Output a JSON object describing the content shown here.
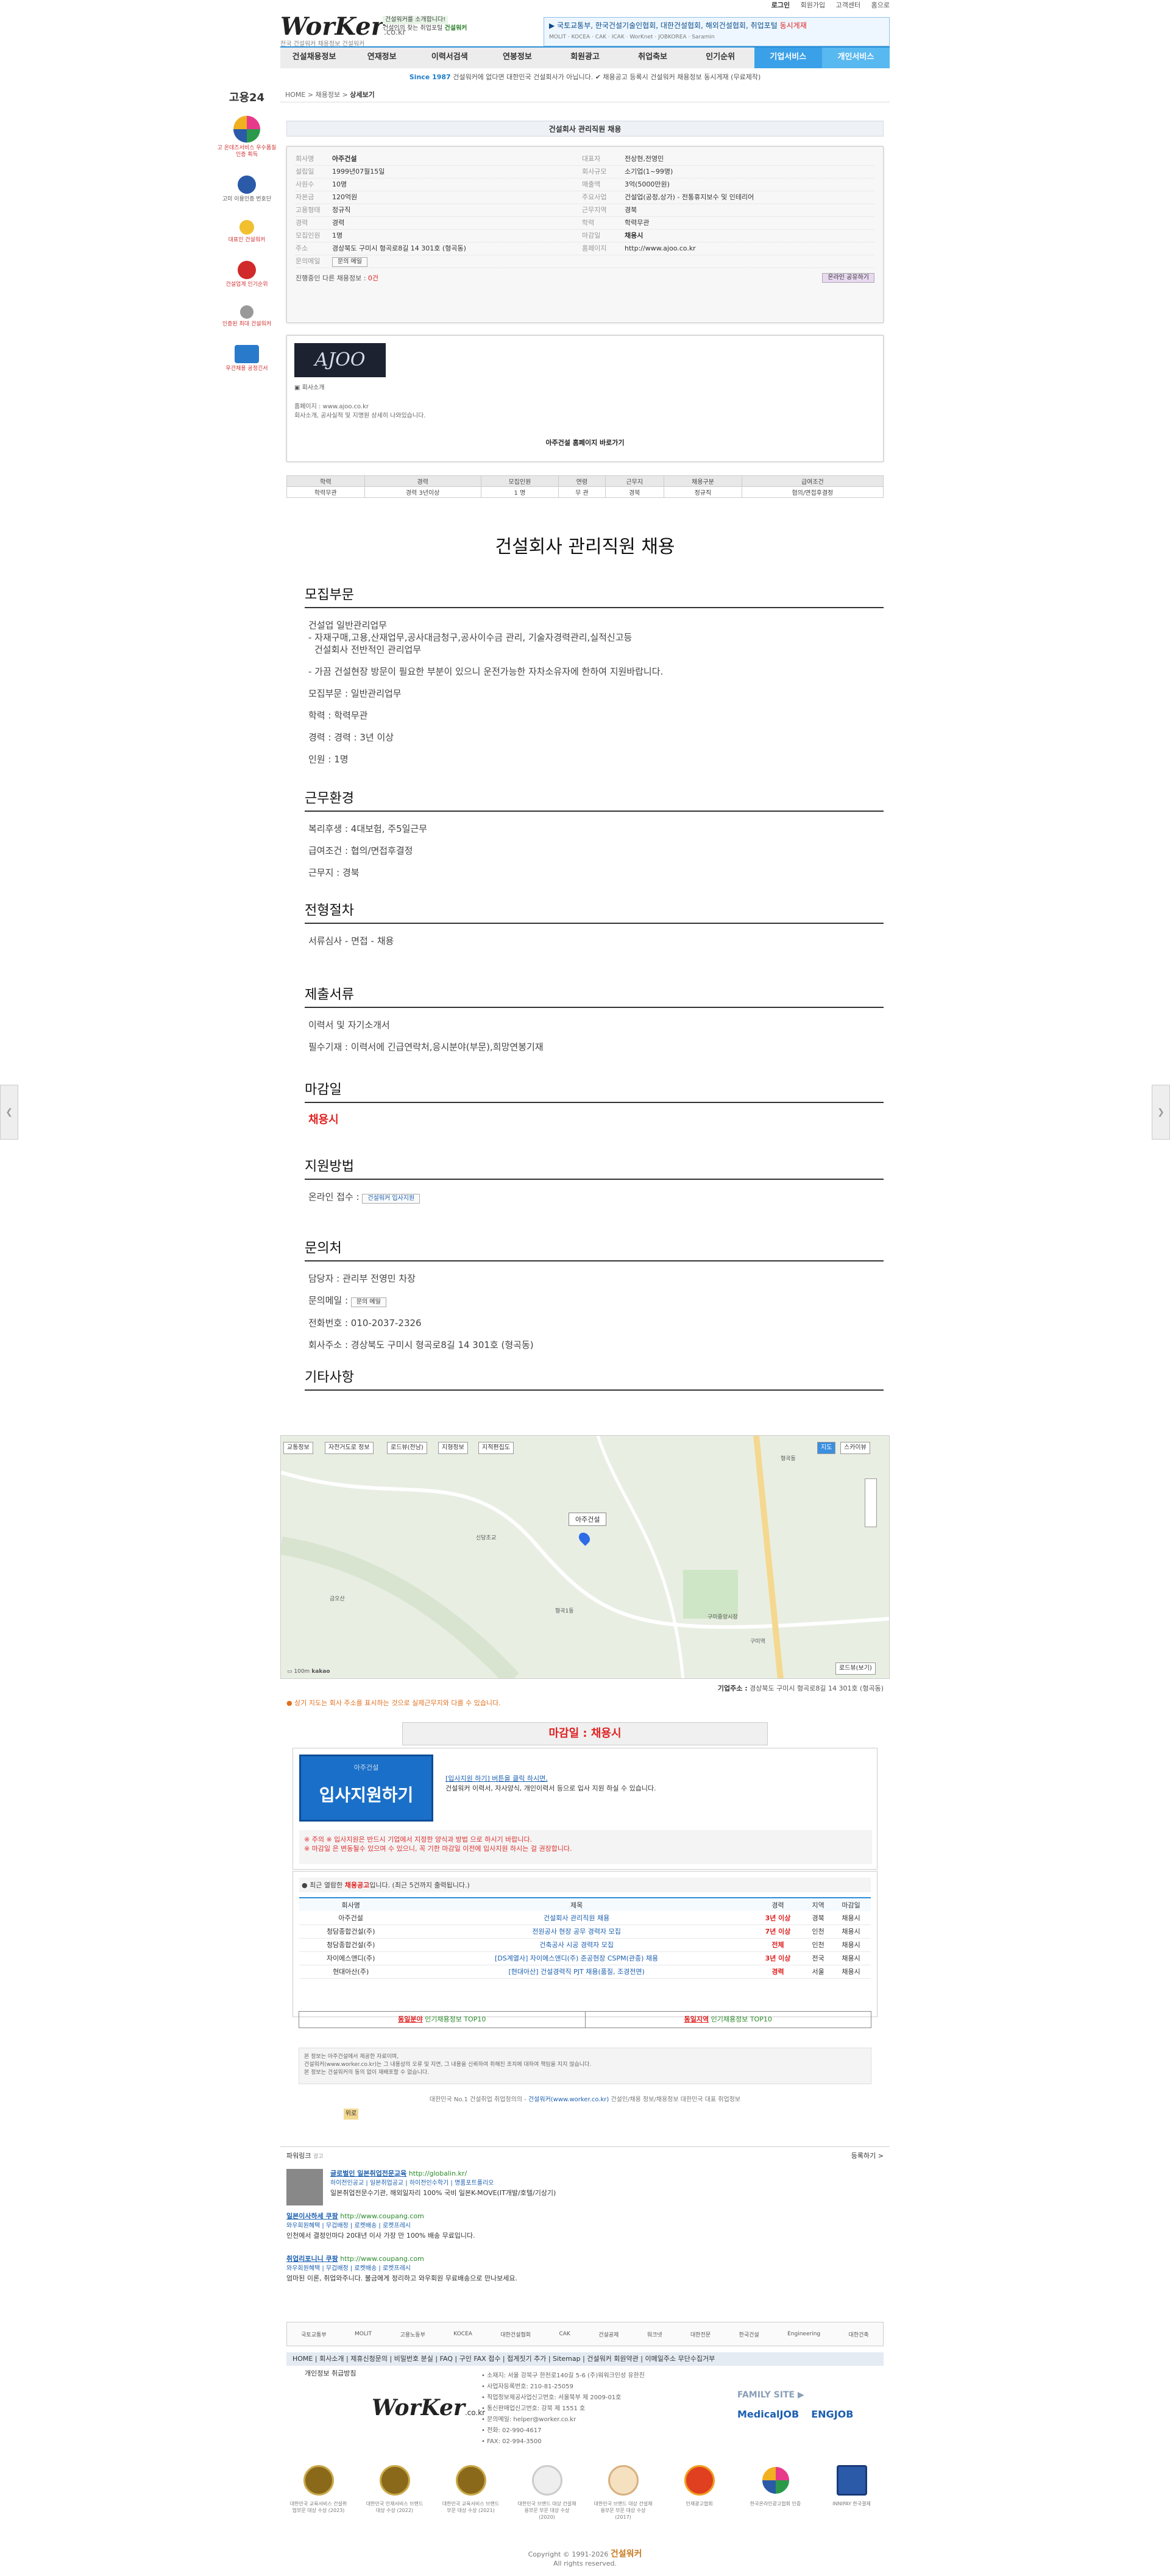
{
  "topbar": {
    "login": "로그인",
    "join": "회원가입",
    "customer": "고객센터",
    "home": "홈으로"
  },
  "logo": {
    "word": "WorKer",
    "domain": ".co.kr",
    "tagline": "전국 건설워커 채용정보 건설워커"
  },
  "hdrbanner": {
    "line1": "건설워커를 소개합니다!",
    "line2": "건설인의 찾는 취업포털",
    "brand": "건설워커"
  },
  "hdrnews": {
    "text": "▶ 국토교통부, 한국건설기술인협회, 대한건설협회, 해외건설협회, 취업포털",
    "highlight": "동시게재",
    "row2": "MOLIT · KOCEA · CAK · ICAK · WorKnet · JOBKOREA · Saramin"
  },
  "gnb": [
    {
      "label": "건설채용정보"
    },
    {
      "label": "연재정보"
    },
    {
      "label": "이력서검색"
    },
    {
      "label": "연봉정보"
    },
    {
      "label": "회원광고"
    },
    {
      "label": "취업축보"
    },
    {
      "label": "인기순위"
    },
    {
      "label": "기업서비스"
    },
    {
      "label": "개인서비스"
    }
  ],
  "since": {
    "lead": "Since 1987",
    "text": "건설워커에 없다면 대한민국 건설회사가 아닙니다. ✔ 채용공고 등록시 건설워커 채용정보 동시게재 (무료제작)"
  },
  "crumb": {
    "home": "HOME",
    "level1": "채용정보",
    "current": "상세보기"
  },
  "leftside": {
    "go24": "고용24",
    "items": [
      {
        "label": "고 온데즈서비스 우수품질인증 획득",
        "color": "#e83a8a"
      },
      {
        "label": "고미 이용인증 번호단",
        "color": "#2a5aa8"
      },
      {
        "label": "대표인 건설워커",
        "color": "#e0a020"
      },
      {
        "label": "건설업계 인기순위",
        "color": "#d02a2a"
      },
      {
        "label": "인증된 최대 건설워커",
        "color": "#666"
      },
      {
        "label": "우건채용 공정긴서",
        "color": "#2a7acc"
      }
    ]
  },
  "job_title_bar": "건설회사 관리직원 채용",
  "info": {
    "rows": [
      {
        "k": "회사명",
        "v": "아주건설",
        "k2": "대표자",
        "v2": "전상현,전영민"
      },
      {
        "k": "설립일",
        "v": "1999년07월15일",
        "k2": "회사규모",
        "v2": "소기업(1~99명)"
      },
      {
        "k": "사원수",
        "v": "10명",
        "k2": "매출액",
        "v2": "3억(5000만원)"
      },
      {
        "k": "자본금",
        "v": "120억원",
        "k2": "주요사업",
        "v2": "건설업(공정,상가) - 전통휴지보수 및 인테리어"
      },
      {
        "k": "고용형태",
        "v": "정규직",
        "k2": "근무지역",
        "v2": "경북"
      },
      {
        "k": "경력",
        "v": "경력",
        "k2": "학력",
        "v2": "학력무관"
      },
      {
        "k": "모집인원",
        "v": "1명",
        "k2": "마감일",
        "v2": "채용시"
      },
      {
        "k": "주소",
        "v": "경상북도 구미시 형곡로8길 14 301호 (형곡동)",
        "k2": "홈페이지",
        "v2": "http://www.ajoo.co.kr"
      }
    ],
    "mail_label": "문의메일",
    "mail_btn": "문의 메일",
    "ongoing_label": "진행중인 다른 채용정보 :",
    "ongoing_count": "0건",
    "share": "온라인 공유하기"
  },
  "company": {
    "logo_text": "AJOO",
    "label": "회사소개",
    "homepage": "홈페이지 : www.ajoo.co.kr",
    "desc": "회사소개, 공사실적 및 지명원 상세히 나와있습니다.",
    "go": "아주건설 홈페이지 바로가기"
  },
  "summary": {
    "headers": [
      "학력",
      "경력",
      "모집인원",
      "연령",
      "근무지",
      "채용구분",
      "급여조건"
    ],
    "values": [
      "학력무관",
      "경력 3년이상",
      "1 명",
      "무 관",
      "경북",
      "정규직",
      "협의/면접후결정"
    ]
  },
  "job_heading": "건설회사 관리직원 채용",
  "sections": {
    "recruit": {
      "h": "모집부문",
      "lines": [
        "건설업 일반관리업무",
        "- 자재구매,고용,산재업무,공사대금청구,공사이수금 관리, 기술자경력관리,실적신고등",
        "  건설회사 전반적인 관리업무"
      ],
      "lines2": [
        "- 가끔 건설현장 방문이 필요한 부분이 있으니 운전가능한 자차소유자에 한하여 지원바랍니다.",
        "모집부문 : 일반관리업무",
        "학력 : 학력무관",
        "경력 : 경력 : 3년 이상",
        "인원 : 1명"
      ]
    },
    "env": {
      "h": "근무환경",
      "lines": [
        "복리후생 : 4대보험, 주5일근무",
        "급여조건 : 협의/면접후결정",
        "근무지 : 경북"
      ]
    },
    "process": {
      "h": "전형절차",
      "lines": [
        "서류심사 - 면접 - 채용"
      ]
    },
    "docs": {
      "h": "제출서류",
      "lines": [
        "이력서 및 자기소개서",
        "필수기재 : 이력서에 긴급연락처,응시분야(부문),희망연봉기재"
      ]
    },
    "deadline": {
      "h": "마감일",
      "value": "채용시"
    },
    "apply": {
      "h": "지원방법",
      "line": "온라인 접수 :",
      "btn": "건설워커 입사지원"
    },
    "contact": {
      "h": "문의처",
      "lines": [
        "담당자 : 관리부 전영민 차장",
        "문의메일 :",
        "전화번호 : 010-2037-2326",
        "회사주소 : 경상북도 구미시 형곡로8길 14 301호 (형곡동)"
      ],
      "btn": "문의 메일"
    },
    "etc": {
      "h": "기타사항"
    }
  },
  "map": {
    "tabs": [
      "교통정보",
      "자전거도로 정보",
      "로드뷰(전남)",
      "지형정보",
      "지적편집도"
    ],
    "view_tabs": [
      "지도",
      "스카이뷰"
    ],
    "pin_label": "아주건설",
    "place_labels": [
      "형곡동",
      "형곡1동",
      "구미중앙시장",
      "구미역",
      "신당초교",
      "금오산"
    ],
    "scale": "100m",
    "brand": "kakao",
    "roadview": "로드뷰(보기)",
    "addr_label": "기업주소 :",
    "addr": "경상북도 구미시 형곡로8길 14 301호 (형곡동)",
    "note": "상기 지도는 회사 주소를 표시하는 것으로 실제근무지와 다를 수 있습니다."
  },
  "deadline_box": "마감일 : 채용시",
  "apply_box": {
    "company": "아주건설",
    "btn": "입사지원하기",
    "line1": "[입사지원 하기] 버튼을 클릭 하시면,",
    "line2": "건설워커 이력서, 자사양식, 개인이력서 등으로 입사 지원 하실 수 있습니다.",
    "note1": "※ 주의  ※ 입사지원은 반드시 기업에서 지정한 양식과 방법 으로 하시기 바랍니다.",
    "note2": "※ 마감일 은 변동될수 있으며 수 있으니, 꼭 기한 마감일 이전에 입사지원 하시는 걸 권장합니다."
  },
  "recent": {
    "label": "최근 열람한",
    "emph": "채용공고",
    "tail": "입니다.  (최근 5건까지 출력됩니다.)",
    "headers": [
      "회사명",
      "제목",
      "경력",
      "지역",
      "마감일"
    ],
    "rows": [
      {
        "c": "아주건설",
        "t": "건설회사 관리직원 채용",
        "e": "3년 이상",
        "r": "경북",
        "d": "채용시"
      },
      {
        "c": "청담종합건설(주)",
        "t": "전원공사 현장 공무 경력자 모집",
        "e": "7년 이상",
        "r": "인천",
        "d": "채용시"
      },
      {
        "c": "청담종합건설(주)",
        "t": "건축공사 시공 경력자 모집",
        "e": "전체",
        "r": "인천",
        "d": "채용시"
      },
      {
        "c": "자이에스앤디(주)",
        "t": "[DS계열사] 자이에스앤디(주) 준공현장 CSPM(관종) 채용",
        "e": "3년 이상",
        "r": "전국",
        "d": "채용시"
      },
      {
        "c": "현대아산(주)",
        "t": "[현대아산] 건설경력직 PJT 채용(품질, 조경전면)",
        "e": "경력",
        "r": "서울",
        "d": "채용시"
      }
    ]
  },
  "rank": {
    "left_r": "동일분야",
    "left_g": "인기채용정보 TOP10",
    "right_r": "동일지역",
    "right_g": "인기채용정보 TOP10"
  },
  "notice": {
    "l1": "본 정보는 아주건설에서 제공한 자료이며,",
    "l2": "건설워커(www.worker.co.kr)는 그 내용상의 오류 및 지연, 그 내용을 신뢰하여 취해진 조치에 대하여 책임을 지지 않습니다.",
    "l3": "본 정보는 건설워커의 동의 없이 재배포할 수 없습니다."
  },
  "copyline": {
    "pre": "대한민국 No.1 건설취업 취업청의의 - ",
    "brand": "건설워커(www.worker.co.kr)",
    "post": " 건설인/채용 정보/채용정보 대한민국 대표 취업정보"
  },
  "top": "위로",
  "ads": {
    "label": "파워링크",
    "sub": "광고",
    "register": "등록하기 >",
    "items": [
      {
        "title": "글로벌인 일본취업전문교육",
        "url": "http://globalin.kr/",
        "links": "하이전인공교 | 일본취업공교 | 하이전인수학기 | 명품포트폴리오",
        "desc": "일본취업전문수기관, 해외일자리 100% 국비 일본K-MOVE(IT개발/호텔/기상기)"
      },
      {
        "title": "일본이사하세 쿠팡",
        "url": "http://www.coupang.com",
        "links": "와우회원혜택 | 무겁배정 | 로켓배송 | 로켓프레시",
        "desc": "인천에서 결정인마다 20대년 이사 가장 만 100% 배송 무료입니다."
      },
      {
        "title": "취업리포니니 쿠팡",
        "url": "http://www.coupang.com",
        "links": "와우회원혜택 | 무겁배정 | 로켓배송 | 로켓프레시",
        "desc": "엄마된 이론, 취업와주니다. 불금에게 정리하고 와우회원 무료배송으로 만나보세요."
      }
    ]
  },
  "partners": [
    "국토교통부",
    "MOLIT",
    "고용노동부",
    "KOCEA",
    "대한건설협회",
    "CAK",
    "건설공제",
    "워크넷",
    "대한전문",
    "한국건설",
    "Engineering",
    "대한건축"
  ],
  "footnav": "HOME | 회사소개 | 제휴신청문의 | 비밀번호 분실 | FAQ | 구인 FAX 접수 | 접게짓기 추가 | Sitemap | 건설워커 회원약관 | 이메일주소 무단수집거부",
  "footsub": "개인정보 취급방침",
  "footinfo": {
    "l1": "• 소재지: 서울 강북구 한천로140길 5-6 (주)워워크인성 유한진",
    "l2": "• 사업자등록번호: 210-81-25059",
    "l3": "• 직업정보제공사업신고번호: 서울북부 제 2009-01호",
    "l4": "• 통신판매업신고번호: 강북 제 1551 호",
    "l5": "• 문의메일: helper@worker.co.kr",
    "l6": "• 전화: 02-990-4617",
    "l7": "• FAX: 02-994-3500"
  },
  "family": {
    "label": "FAMILY SITE ▶",
    "s1": "MedicalJOB",
    "s2": "ENGJOB"
  },
  "certs": [
    {
      "t": "대한민국 교육서비스 건설취업부문 대상 수상 (2023)"
    },
    {
      "t": "대한민국 인재서비스 브랜드 대상 수상 (2022)"
    },
    {
      "t": "대한민국 교육서비스 브랜드 부문 대상 수상 (2021)"
    },
    {
      "t": "대한민국 브랜드 대상 건설채용부문 부문 대상 수상 (2020)"
    },
    {
      "t": "대한민국 브랜드 대상 건설채용부문 부문 대상 수상 (2017)"
    },
    {
      "t": "인재광고협회"
    },
    {
      "t": "한국온라인광고협회 인증"
    },
    {
      "t": "INNIPAY 한국결제"
    }
  ],
  "copy": {
    "pre": "Copyright © 1991-2026",
    "brand": "건설워커",
    "post": "All rights reserved."
  }
}
